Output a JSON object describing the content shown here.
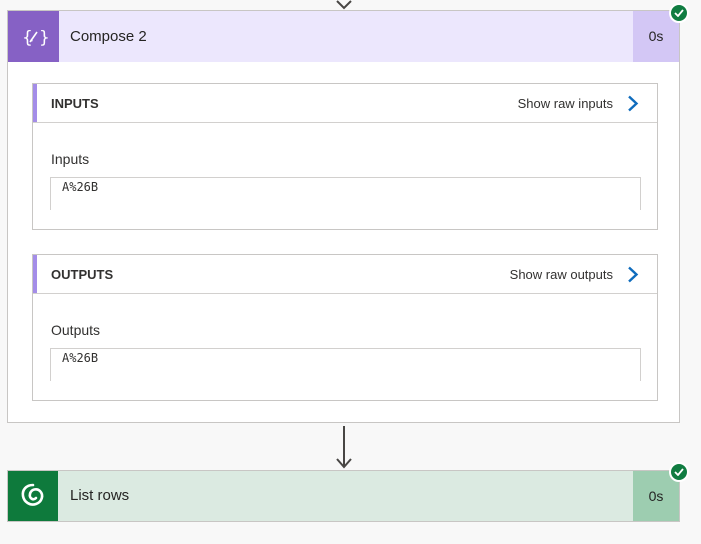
{
  "steps": [
    {
      "title": "Compose 2",
      "duration": "0s",
      "status": "succeeded",
      "icon": "compose-icon",
      "inputs": {
        "heading": "INPUTS",
        "raw_link": "Show raw inputs",
        "field_label": "Inputs",
        "field_value": "A%26B"
      },
      "outputs": {
        "heading": "OUTPUTS",
        "raw_link": "Show raw outputs",
        "field_label": "Outputs",
        "field_value": "A%26B"
      }
    },
    {
      "title": "List rows",
      "duration": "0s",
      "status": "succeeded",
      "icon": "dataverse-icon"
    }
  ],
  "colors": {
    "compose_accent": "#8661c5",
    "compose_header": "#ece7fd",
    "dataverse_accent": "#0e7a3c",
    "dataverse_header": "#dbeae1",
    "success": "#107c41",
    "link_chevron": "#0f6cbd"
  }
}
